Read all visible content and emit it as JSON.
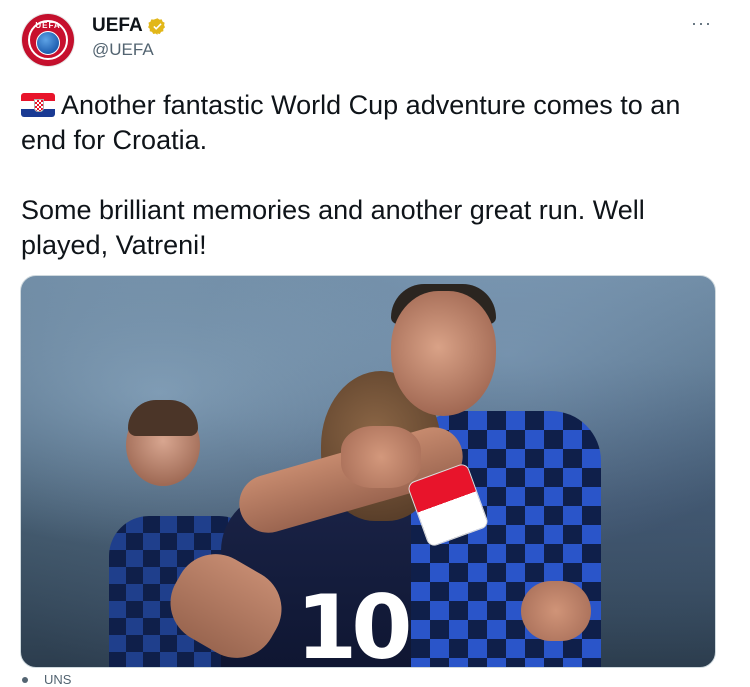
{
  "account": {
    "display_name": "UEFA",
    "handle": "@UEFA",
    "verified": true,
    "avatar_text": "UEFA",
    "avatar_color": "#c8102e"
  },
  "more_menu": {
    "glyph": "···"
  },
  "tweet": {
    "line1": "Another fantastic World Cup adventure comes to an end for Croatia.",
    "line2": "Some brilliant memories and another great run. Well played, Vatreni!",
    "flag_icon": "croatia-flag-icon"
  },
  "media": {
    "jersey_number": "10"
  },
  "source": {
    "label": "UNS"
  },
  "colors": {
    "text": "#0f1419",
    "secondary": "#536471",
    "verified_gold": "#e2b719",
    "border": "#cfd9de"
  }
}
